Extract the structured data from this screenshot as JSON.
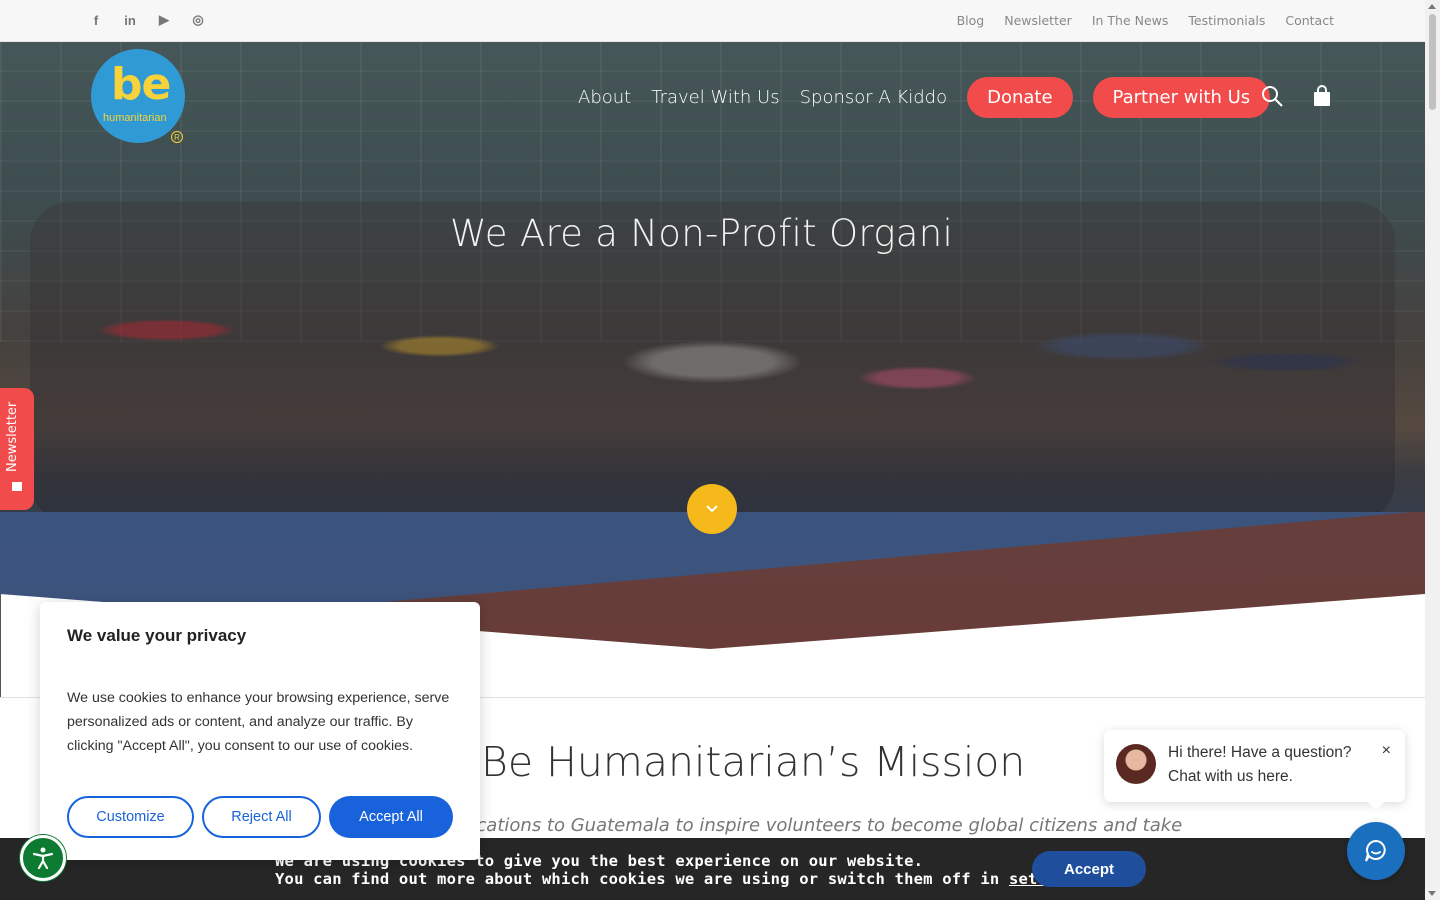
{
  "topbar": {
    "social": [
      {
        "icon": "facebook-icon",
        "glyph": "f"
      },
      {
        "icon": "linkedin-icon",
        "glyph": "in"
      },
      {
        "icon": "youtube-icon",
        "glyph": "▶"
      },
      {
        "icon": "instagram-icon",
        "glyph": "◎"
      }
    ],
    "links": [
      "Blog",
      "Newsletter",
      "In The News",
      "Testimonials",
      "Contact"
    ]
  },
  "logo": {
    "main": "be",
    "sub": "humanitarian",
    "mark": "R"
  },
  "nav": {
    "links": [
      "About",
      "Travel With Us",
      "Sponsor A Kiddo"
    ],
    "donate": "Donate",
    "partner": "Partner with Us"
  },
  "hero": {
    "title": "We Are a Non-Profit Organi"
  },
  "side_tab": {
    "label": "Newsletter"
  },
  "mission": {
    "title": "Be Humanitarian’s Mission",
    "text": "ncations to Guatemala to inspire volunteers to become global citizens and take"
  },
  "privacy": {
    "title": "We value your privacy",
    "body": "We use cookies to enhance your browsing experience, serve personalized ads or content, and analyze our traffic. By clicking \"Accept All\", you consent to our use of cookies.",
    "customize": "Customize",
    "reject": "Reject All",
    "accept_all": "Accept All"
  },
  "cookie_bar": {
    "line1": "We are using cookies to give you the best experience on our website.",
    "line2_prefix": "You can find out more about which cookies we are using or switch them off in ",
    "line2_link": "settings",
    "line2_suffix": ".",
    "accept": "Accept"
  },
  "chat": {
    "message": "Hi there! Have a question? Chat with us here.",
    "close": "×"
  },
  "colors": {
    "accent_red": "#f14b4b",
    "logo_blue": "#2f9ad4",
    "logo_yellow": "#f7d23a",
    "scroll_yellow": "#f5b91c",
    "privacy_blue": "#1863dc",
    "cookie_accept": "#1f4e9c",
    "a11y_green": "#0c7a30",
    "chat_blue": "#1a6fbf"
  }
}
